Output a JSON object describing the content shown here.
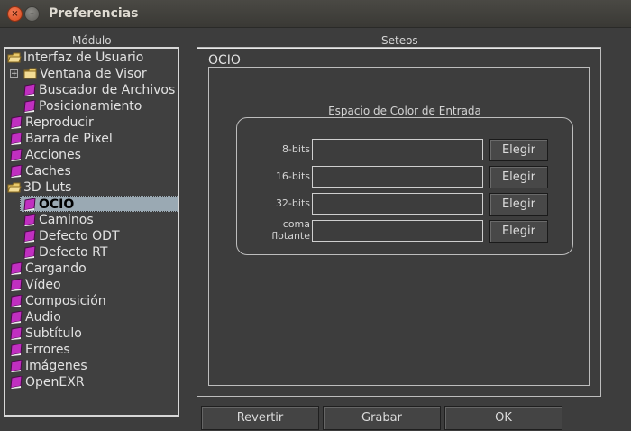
{
  "window": {
    "title": "Preferencias"
  },
  "labels": {
    "modulo": "Módulo",
    "seteos": "Seteos"
  },
  "tree": {
    "items": [
      {
        "label": "Interfaz de Usuario",
        "icon": "open-folder-icon"
      },
      {
        "label": "Ventana de Visor",
        "icon": "folder-icon"
      },
      {
        "label": "Buscador de Archivos",
        "icon": "book-icon"
      },
      {
        "label": "Posicionamiento",
        "icon": "book-icon"
      },
      {
        "label": "Reproducir",
        "icon": "book-icon"
      },
      {
        "label": "Barra de Pixel",
        "icon": "book-icon"
      },
      {
        "label": "Acciones",
        "icon": "book-icon"
      },
      {
        "label": "Caches",
        "icon": "book-icon"
      },
      {
        "label": "3D Luts",
        "icon": "open-folder-icon"
      },
      {
        "label": "OCIO",
        "icon": "book-icon",
        "selected": true
      },
      {
        "label": "Caminos",
        "icon": "book-icon"
      },
      {
        "label": "Defecto ODT",
        "icon": "book-icon"
      },
      {
        "label": "Defecto RT",
        "icon": "book-icon"
      },
      {
        "label": "Cargando",
        "icon": "book-icon"
      },
      {
        "label": "Vídeo",
        "icon": "book-icon"
      },
      {
        "label": "Composición",
        "icon": "book-icon"
      },
      {
        "label": "Audio",
        "icon": "book-icon"
      },
      {
        "label": "Subtítulo",
        "icon": "book-icon"
      },
      {
        "label": "Errores",
        "icon": "book-icon"
      },
      {
        "label": "Imágenes",
        "icon": "book-icon"
      },
      {
        "label": "OpenEXR",
        "icon": "book-icon"
      }
    ]
  },
  "panel": {
    "title": "OCIO",
    "group_title": "Espacio de Color de Entrada",
    "rows": [
      {
        "label": "8-bits",
        "value": "",
        "button": "Elegir"
      },
      {
        "label": "16-bits",
        "value": "",
        "button": "Elegir"
      },
      {
        "label": "32-bits",
        "value": "",
        "button": "Elegir"
      },
      {
        "label": "coma flotante",
        "label_line1": "coma",
        "label_line2": "flotante",
        "value": "",
        "button": "Elegir"
      }
    ]
  },
  "buttons": {
    "revert": "Revertir",
    "save": "Grabar",
    "ok": "OK"
  },
  "colors": {
    "background": "#3d3d3d",
    "selection": "#9aa9b3",
    "book_icon": "#c02fc0",
    "folder_icon": "#e8c86a"
  }
}
